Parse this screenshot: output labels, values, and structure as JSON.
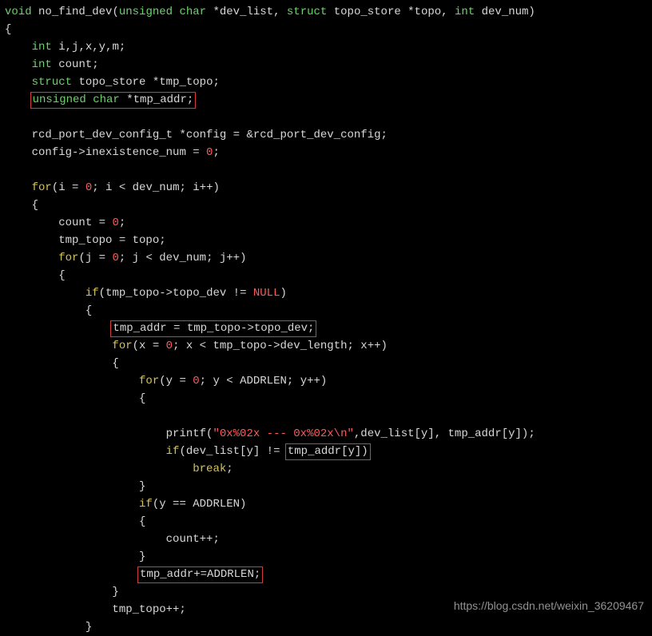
{
  "code": {
    "fn_ret": "void",
    "fn_name": "no_find_dev",
    "p1_type_a": "unsigned char",
    "p1_name": "*dev_list",
    "p2_kw": "struct",
    "p2_type": "topo_store",
    "p2_name": "*topo",
    "p3_type": "int",
    "p3_name": "dev_num",
    "int_kw": "int",
    "decl_ijxym": "i,j,x,y,m;",
    "decl_count": "count;",
    "struct_kw": "struct",
    "tmp_topo_type": "topo_store",
    "tmp_topo_name": "*tmp_topo;",
    "uc_kw": "unsigned char",
    "tmp_addr_name": "*tmp_addr;",
    "cfg_line": "rcd_port_dev_config_t *config = &rcd_port_dev_config;",
    "cfg_zero_pre": "config->inexistence_num = ",
    "zero": "0",
    "for_kw": "for",
    "if_kw": "if",
    "break_kw": "break",
    "outer_for_head_a": "(i = ",
    "outer_for_head_b": "; i < dev_num; i++)",
    "count_eq": "count = ",
    "tmp_topo_assign": "tmp_topo = topo;",
    "inner_for_head_a": "(j = ",
    "inner_for_head_b": "; j < dev_num; j++)",
    "if_topo_dev": "(tmp_topo->topo_dev != ",
    "null_kw": "NULL",
    "tmp_addr_assign": "tmp_addr = tmp_topo->topo_dev;",
    "for_x_a": "(x = ",
    "for_x_b": "; x < tmp_topo->dev_length; x++)",
    "for_y_a": "(y = ",
    "for_y_b": "; y < ADDRLEN; y++)",
    "printf_pre": "printf(",
    "printf_fmt": "\"0x%02x --- 0x%02x\\n\"",
    "printf_args": ",dev_list[y], tmp_addr[y]);",
    "if_dev_a": "(dev_list[y] != ",
    "if_dev_box": "tmp_addr[y])",
    "if_y_eq": "(y == ADDRLEN)",
    "count_pp": "count++;",
    "tmp_addr_inc": "tmp_addr+=ADDRLEN;",
    "tmp_topo_pp": "tmp_topo++;"
  },
  "watermark": "https://blog.csdn.net/weixin_36209467"
}
